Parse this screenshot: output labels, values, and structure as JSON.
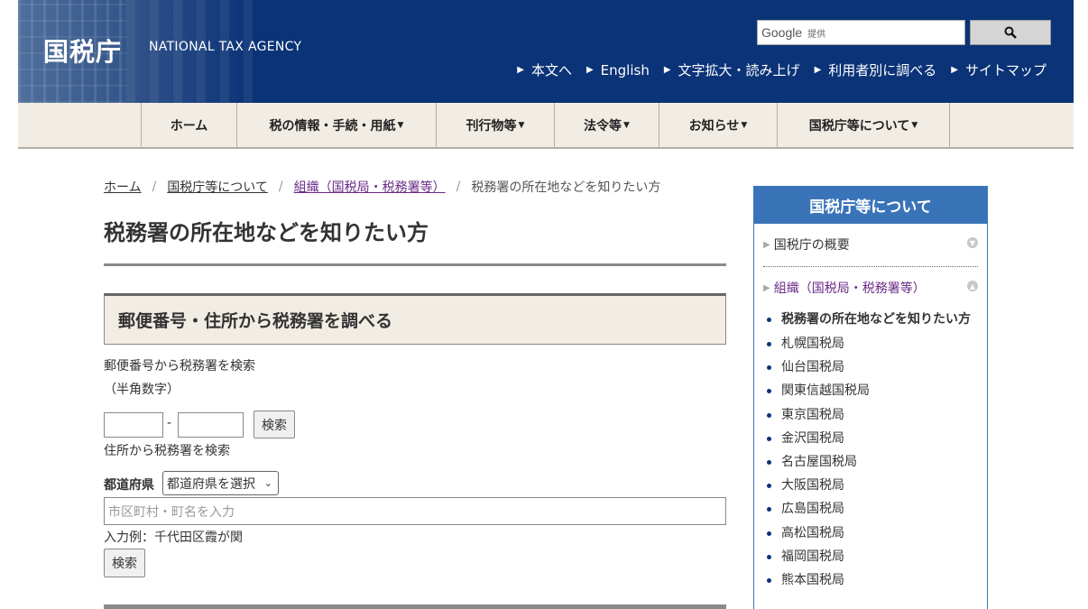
{
  "header": {
    "logo": "国税庁",
    "logo_en": "NATIONAL TAX AGENCY",
    "search": {
      "brand": "Google",
      "brand_sub": "提供"
    },
    "util_nav": [
      "本文へ",
      "English",
      "文字拡大・読み上げ",
      "利用者別に調べる",
      "サイトマップ"
    ]
  },
  "gnav": [
    "ホーム",
    "税の情報・手続・用紙",
    "刊行物等",
    "法令等",
    "お知らせ",
    "国税庁等について"
  ],
  "breadcrumb": [
    "ホーム",
    "国税庁等について",
    "組織（国税局・税務署等）",
    "税務署の所在地などを知りたい方"
  ],
  "main": {
    "title": "税務署の所在地などを知りたい方",
    "section_title": "郵便番号・住所から税務署を調べる",
    "postal_label": "郵便番号から税務署を検索",
    "postal_note": "（半角数字）",
    "dash": "-",
    "search_button": "検索",
    "address_label": "住所から税務署を検索",
    "pref_label": "都道府県",
    "pref_select": "都道府県を選択",
    "city_placeholder": "市区町村・町名を入力",
    "example": "入力例：千代田区霞が関",
    "search_button2": "検索"
  },
  "sidebar": {
    "title": "国税庁等について",
    "links": [
      "国税庁の概要",
      "組織（国税局・税務署等）"
    ],
    "items": [
      "税務署の所在地などを知りたい方",
      "札幌国税局",
      "仙台国税局",
      "関東信越国税局",
      "東京国税局",
      "金沢国税局",
      "名古屋国税局",
      "大阪国税局",
      "広島国税局",
      "高松国税局",
      "福岡国税局",
      "熊本国税局"
    ]
  }
}
